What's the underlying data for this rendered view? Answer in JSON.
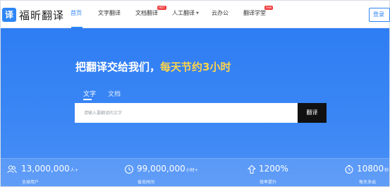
{
  "logo": {
    "icon_text": "译",
    "name": "福昕翻译",
    "icon": "translate-logo-icon"
  },
  "nav": {
    "items": [
      {
        "label": "首页",
        "active": true
      },
      {
        "label": "文字翻译"
      },
      {
        "label": "文档翻译",
        "badge": "HOT"
      },
      {
        "label": "人工翻译"
      },
      {
        "label": "云办公"
      },
      {
        "label": "翻译学堂",
        "badge": "new"
      }
    ],
    "login_label": "登录"
  },
  "hero": {
    "title_main": "把翻译交给我们，",
    "title_highlight": "每天节约3小时",
    "highlight_color": "#ffd44a",
    "tabs": [
      {
        "label": "文字",
        "active": true
      },
      {
        "label": "文档"
      }
    ],
    "search": {
      "placeholder": "请输入要翻译的文字",
      "value": ""
    },
    "translate_label": "翻译"
  },
  "stats": [
    {
      "icon": "users-icon",
      "value": "13,000,000",
      "unit": "人+",
      "label": "全球用户"
    },
    {
      "icon": "clock-icon",
      "value": "99,000,000",
      "unit": "小时+",
      "label": "省去时间"
    },
    {
      "icon": "arrow-up-icon",
      "value": "1200%",
      "unit": "",
      "label": "效率提升"
    },
    {
      "icon": "timer-icon",
      "value": "10800",
      "unit": "秒",
      "label": "每天多出"
    }
  ],
  "colors": {
    "accent": "#2f86f6",
    "hero_bg": "#3a86f5",
    "button_dark": "#111111",
    "badge_red": "#f03c3c"
  }
}
